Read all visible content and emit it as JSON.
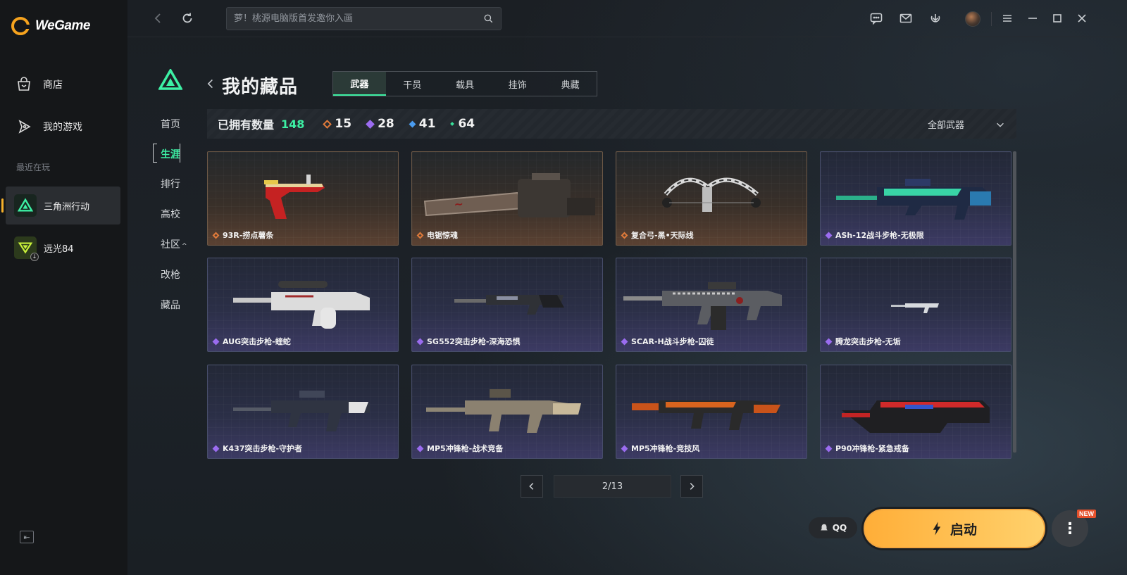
{
  "app": {
    "name": "WeGame"
  },
  "sidebar": {
    "nav": [
      {
        "label": "商店",
        "icon": "store-bag-icon"
      },
      {
        "label": "我的游戏",
        "icon": "my-games-icon"
      }
    ],
    "recent_label": "最近在玩",
    "recent": [
      {
        "label": "三角洲行动",
        "icon": "delta-force-icon",
        "active": true
      },
      {
        "label": "远光84",
        "icon": "farlight84-icon",
        "active": false
      }
    ]
  },
  "topbar": {
    "search_placeholder": "萝！桃源电脑版首发邀你入画"
  },
  "game_nav": [
    "首页",
    "生涯",
    "排行",
    "高校",
    "社区",
    "改枪",
    "藏品"
  ],
  "game_nav_active": "生涯",
  "header": {
    "title": "我的藏品",
    "tabs": [
      "武器",
      "干员",
      "载具",
      "挂饰",
      "典藏"
    ],
    "active_tab": "武器"
  },
  "owned": {
    "label": "已拥有数量",
    "count": "148",
    "rarities": [
      {
        "value": "15",
        "color": "#e07a3a"
      },
      {
        "value": "28",
        "color": "#9b6cf0"
      },
      {
        "value": "41",
        "color": "#4a9cf0"
      },
      {
        "value": "64",
        "color": "#39e09a"
      }
    ],
    "filter": "全部武器"
  },
  "items": [
    {
      "name": "93R-捞点薯条",
      "rarity": "gold"
    },
    {
      "name": "电锯惊魂",
      "rarity": "gold"
    },
    {
      "name": "复合弓-黑•天际线",
      "rarity": "gold"
    },
    {
      "name": "ASh-12战斗步枪-无极限",
      "rarity": "purple"
    },
    {
      "name": "AUG突击步枪-蝰蛇",
      "rarity": "purple"
    },
    {
      "name": "SG552突击步枪-深海恐惧",
      "rarity": "purple"
    },
    {
      "name": "SCAR-H战斗步枪-囚徒",
      "rarity": "purple"
    },
    {
      "name": "腾龙突击步枪-无垢",
      "rarity": "purple"
    },
    {
      "name": "K437突击步枪-守护者",
      "rarity": "purple"
    },
    {
      "name": "MP5冲锋枪-战术竞备",
      "rarity": "purple"
    },
    {
      "name": "MP5冲锋枪-竞技风",
      "rarity": "purple"
    },
    {
      "name": "P90冲锋枪-紧急戒备",
      "rarity": "purple"
    }
  ],
  "pager": {
    "text": "2/13"
  },
  "launch": {
    "qq": "QQ",
    "label": "启动",
    "badge": "NEW"
  },
  "colors": {
    "accent": "#3df0a4",
    "launch": "#ffbe4a",
    "gold": "#e07a3a",
    "purple": "#9b6cf0"
  }
}
